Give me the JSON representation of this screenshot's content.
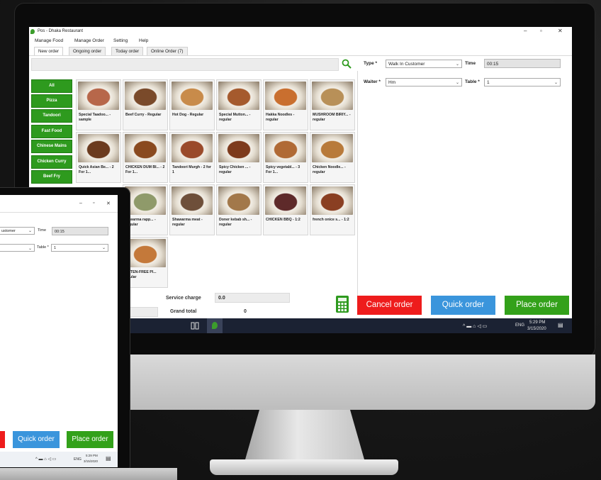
{
  "window": {
    "title": "Pos - Dhaka Restaurant",
    "controls": {
      "minimize": "–",
      "maximize": "▫",
      "close": "✕"
    }
  },
  "menu": [
    "Manage Food",
    "Manage Order",
    "Setting",
    "Help"
  ],
  "tabs": [
    "New order",
    "Ongoing order",
    "Today order",
    "Online Order (7)"
  ],
  "search": {
    "placeholder": "",
    "icon": "search-icon"
  },
  "categories": [
    "All",
    "Pizza",
    "Tandoori",
    "Fast Food",
    "Chinese Mains",
    "Chicken Curry",
    "Beef Fry"
  ],
  "foods": [
    {
      "name": "Special Taadoo... - sample",
      "color": "#b7674a"
    },
    {
      "name": "Beef Curry - Regular",
      "color": "#7a4a2a"
    },
    {
      "name": "Hot Dog - Regular",
      "color": "#c88b4a"
    },
    {
      "name": "Special Mutton... - regular",
      "color": "#a55a2d"
    },
    {
      "name": "Hakka Noodles - regular",
      "color": "#c96f2f"
    },
    {
      "name": "MUSHROOM BIRIY... - regular",
      "color": "#b89058"
    },
    {
      "name": "Quick Asian Be... - 2 For 1...",
      "color": "#6b3b1f"
    },
    {
      "name": "CHICKEN DUM BI... - 2 For 1...",
      "color": "#8a4a1f"
    },
    {
      "name": "Tandoori Murgh - 2 for 1",
      "color": "#9a4a2a"
    },
    {
      "name": "Spicy Chicken ... - regular",
      "color": "#7d3a1c"
    },
    {
      "name": "Spicy vegetabl... - 3 For 1...",
      "color": "#b06a35"
    },
    {
      "name": "Chicken Noodle... - regular",
      "color": "#b87a3a"
    },
    {
      "name": "hawarma rapp... - regular",
      "color": "#8f9a6a"
    },
    {
      "name": "Shawarma meat - regular",
      "color": "#6e4f3a"
    },
    {
      "name": "Doner kebab sh... - regular",
      "color": "#a2784a"
    },
    {
      "name": "CHICKEN BBQ - 1:2",
      "color": "#5e2a2a"
    },
    {
      "name": "french onice s... - 1:2",
      "color": "#8a3f22"
    },
    {
      "name": "LUTEN-FREE PI... egular",
      "color": "#c4793a"
    }
  ],
  "order_form": {
    "type_label": "Type *",
    "type_value": "Walk In Customer",
    "time_label": "Time",
    "time_value": "00:15",
    "waiter_label": "Waiter *",
    "waiter_value": "Hm",
    "table_label": "Table *",
    "table_value": "1"
  },
  "totals": {
    "service_charge_label": "Service charge",
    "service_charge_value": "0.0",
    "grand_total_label": "Grand total",
    "grand_total_value": "0"
  },
  "actions": {
    "cancel": "Cancel order",
    "quick": "Quick order",
    "place": "Place order"
  },
  "colors": {
    "cancel": "#ee1c1c",
    "quick": "#3a95dc",
    "place": "#33a11a",
    "category": "#2e9a1e"
  },
  "taskbar": {
    "lang": "ENG",
    "time": "5:29 PM",
    "date": "3/15/2020"
  },
  "small_screen": {
    "type_value": "ustomer",
    "time_label": "Time",
    "time_value": "00:15",
    "table_label": "Table *",
    "table_value": "1",
    "quick": "Quick order",
    "place": "Place order",
    "lang": "ENG",
    "time": "5:29 PM",
    "date": "3/15/2020"
  }
}
